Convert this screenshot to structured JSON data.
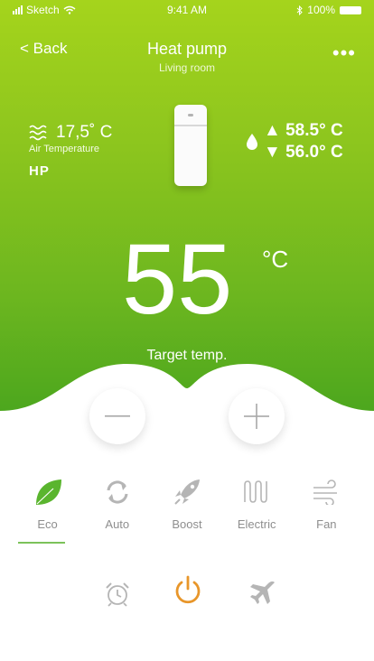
{
  "status_bar": {
    "carrier": "Sketch",
    "time": "9:41 AM",
    "battery": "100%"
  },
  "nav": {
    "back_label": "< Back",
    "title": "Heat pump",
    "subtitle": "Living room",
    "more_label": "•••"
  },
  "air": {
    "temperature": "17,5˚ C",
    "label": "Air Temperature",
    "badge": "HP"
  },
  "water": {
    "high": "▲ 58.5° C",
    "low": "▼ 56.0° C"
  },
  "target": {
    "value": "55",
    "unit": "°C",
    "label": "Target temp."
  },
  "modes": [
    {
      "label": "Eco",
      "icon": "leaf-icon",
      "selected": true
    },
    {
      "label": "Auto",
      "icon": "refresh-icon",
      "selected": false
    },
    {
      "label": "Boost",
      "icon": "rocket-icon",
      "selected": false
    },
    {
      "label": "Electric",
      "icon": "heater-icon",
      "selected": false
    },
    {
      "label": "Fan",
      "icon": "wind-icon",
      "selected": false
    }
  ],
  "actions": [
    {
      "icon": "alarm-clock-icon"
    },
    {
      "icon": "power-icon"
    },
    {
      "icon": "airplane-icon"
    }
  ],
  "colors": {
    "accent": "#8cc51e",
    "eco_green": "#5ab52e",
    "power_orange": "#e8962a",
    "inactive": "#b5b5b5"
  }
}
